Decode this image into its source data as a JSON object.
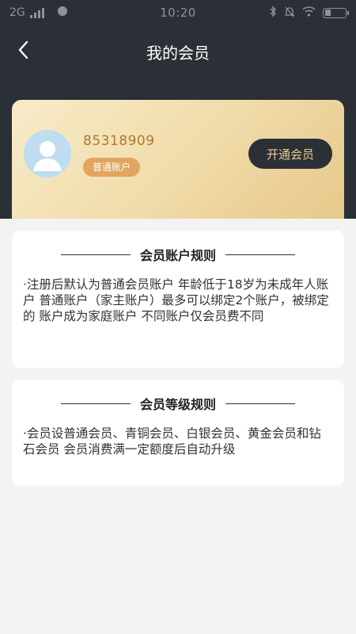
{
  "status_bar": {
    "network": "2G",
    "time": "10:20",
    "icons": [
      "signal-icon",
      "compass-icon",
      "bluetooth-icon",
      "mute-icon",
      "wifi-icon",
      "battery-icon"
    ]
  },
  "nav": {
    "back_icon": "back-arrow-icon",
    "title": "我的会员"
  },
  "member_card": {
    "user_id": "85318909",
    "account_type": "普通账户",
    "open_button": "开通会员",
    "avatar_icon": "avatar-icon"
  },
  "rules": [
    {
      "title": "会员账户规则",
      "text": "·注册后默认为普通会员账户 年龄低于18岁为未成年人账户 普通账户（家主账户）最多可以绑定2个账户，被绑定的 账户成为家庭账户 不同账户仅会员费不同"
    },
    {
      "title": "会员等级规则",
      "text": "·会员设普通会员、青铜会员、白银会员、黄金会员和钻石会员  会员消费满一定额度后自动升级"
    }
  ],
  "colors": {
    "header_bg": "#2b2f36",
    "gold_text": "#b0792c",
    "badge": "#e2a55d",
    "button_text": "#ecc993",
    "page_bg": "#f3f3f4"
  }
}
